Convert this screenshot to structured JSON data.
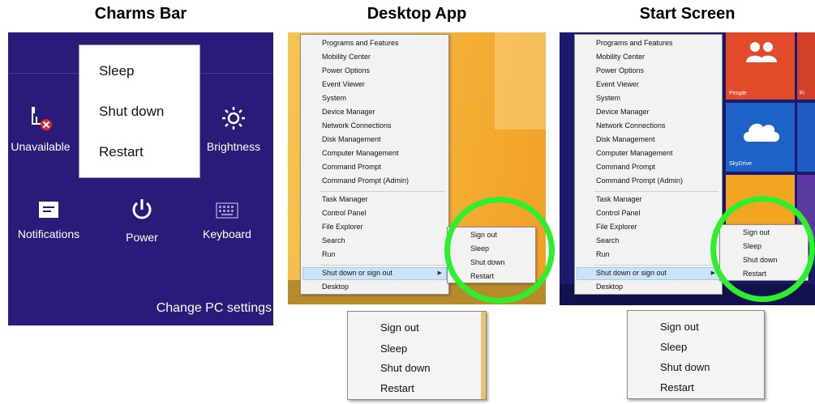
{
  "headings": {
    "charms": "Charms Bar",
    "desktop": "Desktop App",
    "start": "Start Screen"
  },
  "charms": {
    "power_menu": [
      "Sleep",
      "Shut down",
      "Restart"
    ],
    "tiles": {
      "network": "Unavailable",
      "brightness": "Brightness",
      "notifications": "Notifications",
      "power": "Power",
      "keyboard": "Keyboard"
    },
    "settings_link": "Change PC settings"
  },
  "context_menu": {
    "items": [
      "Programs and Features",
      "Mobility Center",
      "Power Options",
      "Event Viewer",
      "System",
      "Device Manager",
      "Network Connections",
      "Disk Management",
      "Computer Management",
      "Command Prompt",
      "Command Prompt (Admin)",
      "Task Manager",
      "Control Panel",
      "File Explorer",
      "Search",
      "Run",
      "Shut down or sign out",
      "Desktop"
    ],
    "submenu": [
      "Sign out",
      "Sleep",
      "Shut down",
      "Restart"
    ]
  },
  "start_tiles": {
    "people": "People",
    "fi": "Fi",
    "skydrive": "SkyDrive"
  },
  "colors": {
    "charms_bg": "#2a1a7a",
    "start_bg": "#1b1b6e",
    "highlight_ring": "#2df02d",
    "desktop_bg": "#f5b33b"
  },
  "icons": [
    "network-unavailable-icon",
    "brightness-icon",
    "notifications-icon",
    "power-icon",
    "keyboard-icon",
    "people-icon",
    "cloud-icon",
    "submenu-arrow-icon"
  ]
}
